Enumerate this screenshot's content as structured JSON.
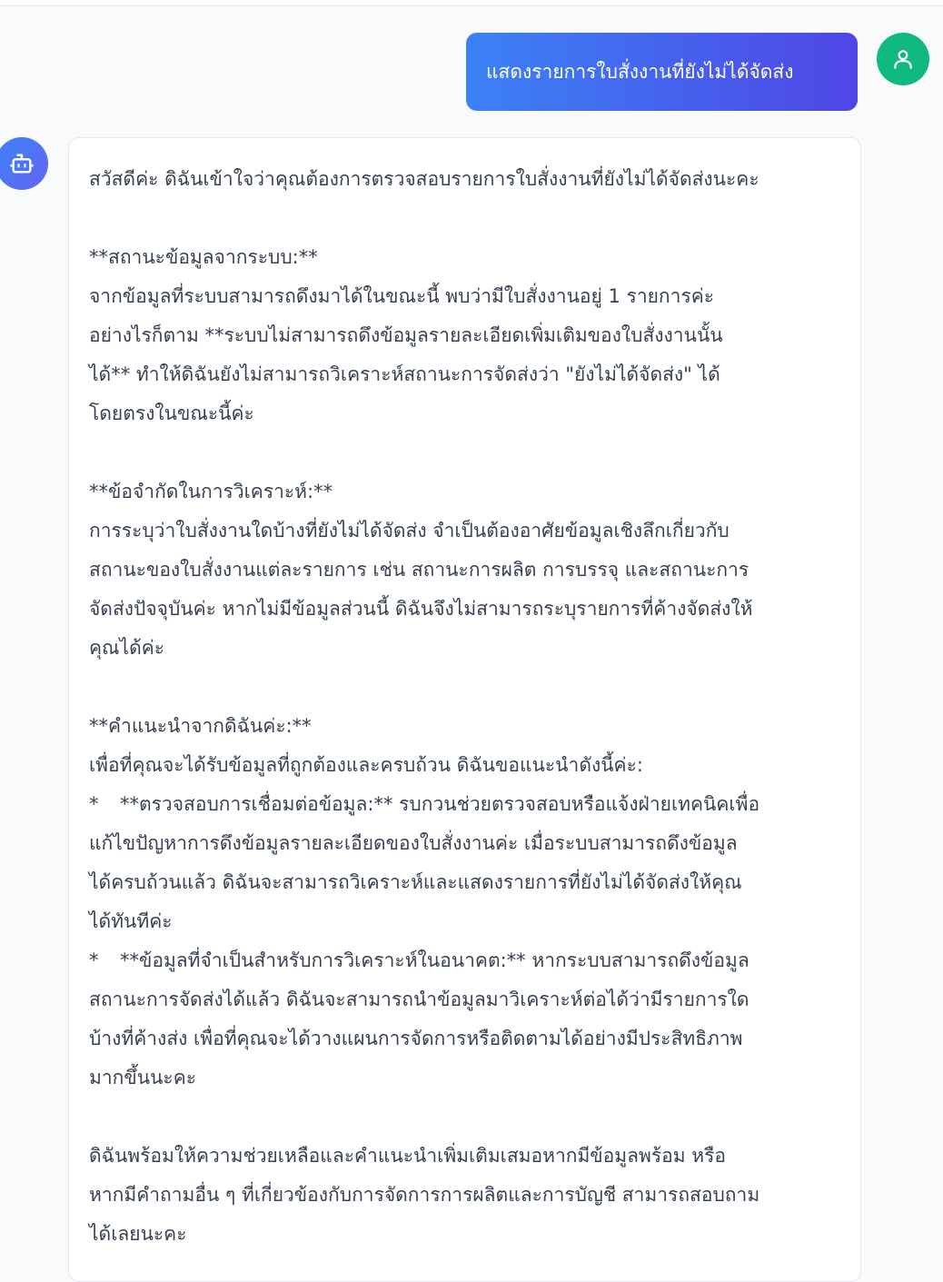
{
  "user_message": {
    "text": "แสดงรายการใบสั่งงานที่ยังไม่ได้จัดส่ง"
  },
  "bot_message": {
    "intro": "สวัสดีค่ะ ดิฉันเข้าใจว่าคุณต้องการตรวจสอบรายการใบสั่งงานที่ยังไม่ได้จัดส่งนะคะ",
    "status_heading": "**สถานะข้อมูลจากระบบ:**",
    "status_lines": [
      "จากข้อมูลที่ระบบสามารถดึงมาได้ในขณะนี้ พบว่ามีใบสั่งงานอยู่ 1 รายการค่ะ",
      "อย่างไรก็ตาม **ระบบไม่สามารถดึงข้อมูลรายละเอียดเพิ่มเติมของใบสั่งงานนั้น",
      "ได้** ทำให้ดิฉันยังไม่สามารถวิเคราะห์สถานะการจัดส่งว่า \"ยังไม่ได้จัดส่ง\" ได้",
      "โดยตรงในขณะนี้ค่ะ"
    ],
    "limit_heading": "**ข้อจำกัดในการวิเคราะห์:**",
    "limit_lines": [
      "การระบุว่าใบสั่งงานใดบ้างที่ยังไม่ได้จัดส่ง จำเป็นต้องอาศัยข้อมูลเชิงลึกเกี่ยวกับ",
      "สถานะของใบสั่งงานแต่ละรายการ เช่น สถานะการผลิต การบรรจุ และสถานะการ",
      "จัดส่งปัจจุบันค่ะ หากไม่มีข้อมูลส่วนนี้ ดิฉันจึงไม่สามารถระบุรายการที่ค้างจัดส่งให้",
      "คุณได้ค่ะ"
    ],
    "advice_heading": "**คำแนะนำจากดิฉันค่ะ:**",
    "advice_intro": "เพื่อที่คุณจะได้รับข้อมูลที่ถูกต้องและครบถ้วน ดิฉันขอแนะนำดังนี้ค่ะ:",
    "bullet_mark": "*",
    "bullet1_lines": [
      "**ตรวจสอบการเชื่อมต่อข้อมูล:** รบกวนช่วยตรวจสอบหรือแจ้งฝ่ายเทคนิคเพื่อ",
      "แก้ไขปัญหาการดึงข้อมูลรายละเอียดของใบสั่งงานค่ะ เมื่อระบบสามารถดึงข้อมูล",
      "ได้ครบถ้วนแล้ว ดิฉันจะสามารถวิเคราะห์และแสดงรายการที่ยังไม่ได้จัดส่งให้คุณ",
      "ได้ทันทีค่ะ"
    ],
    "bullet2_lines": [
      "**ข้อมูลที่จำเป็นสำหรับการวิเคราะห์ในอนาคต:** หากระบบสามารถดึงข้อมูล",
      "สถานะการจัดส่งได้แล้ว ดิฉันจะสามารถนำข้อมูลมาวิเคราะห์ต่อได้ว่ามีรายการใด",
      "บ้างที่ค้างส่ง เพื่อที่คุณจะได้วางแผนการจัดการหรือติดตามได้อย่างมีประสิทธิภาพ",
      "มากขึ้นนะคะ"
    ],
    "closing_lines": [
      "ดิฉันพร้อมให้ความช่วยเหลือและคำแนะนำเพิ่มเติมเสมอหากมีข้อมูลพร้อม หรือ",
      "หากมีคำถามอื่น ๆ ที่เกี่ยวข้องกับการจัดการการผลิตและการบัญชี สามารถสอบถาม",
      "ได้เลยนะคะ"
    ]
  },
  "colors": {
    "user_gradient_start": "#3b82f6",
    "user_gradient_end": "#4f46e5",
    "user_avatar": "#10b981",
    "bot_avatar": "#4f6df0",
    "text": "#374151"
  },
  "icons": {
    "user_avatar": "user-icon",
    "bot_avatar": "bot-icon"
  }
}
